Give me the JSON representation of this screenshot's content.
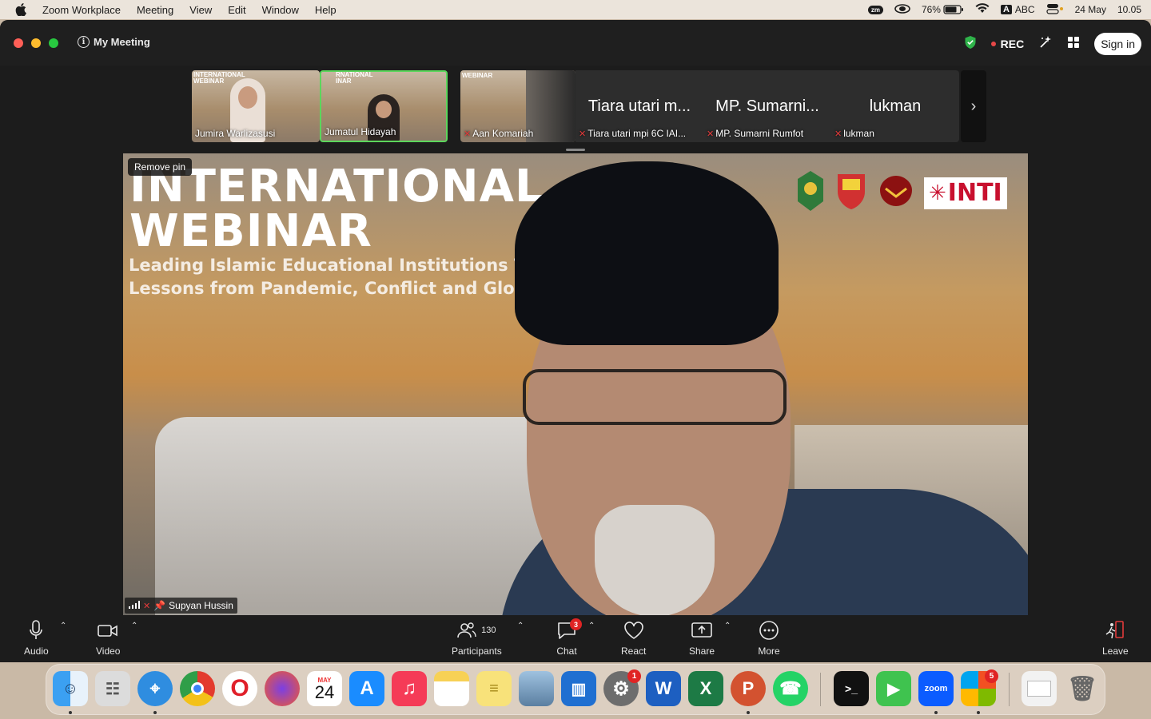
{
  "menubar": {
    "app_name": "Zoom Workplace",
    "items": [
      "Meeting",
      "View",
      "Edit",
      "Window",
      "Help"
    ],
    "status": {
      "zm": "zm",
      "battery": "76%",
      "input": "ABC",
      "input_letter": "A",
      "date": "24 May",
      "time": "10.05"
    }
  },
  "window": {
    "title": "My Meeting",
    "rec_label": "REC",
    "sign_in_label": "Sign in"
  },
  "strip": {
    "tiles": [
      {
        "name": "Jumira Warlizasusi",
        "thumb_line1": "INTERNATIONAL",
        "thumb_line2": "WEBINAR"
      },
      {
        "name": "Jumatul Hidayah",
        "thumb_line1": "RNATIONAL",
        "thumb_line2": "INAR"
      },
      {
        "name": "Aan Komariah",
        "thumb_line1": "WEBINAR"
      },
      {
        "name": "Tiara utari mpi 6C  IAI...",
        "big": "Tiara utari m..."
      },
      {
        "name": "MP. Sumarni Rumfot",
        "big": "MP. Sumarni..."
      },
      {
        "name": "lukman",
        "big": "lukman"
      }
    ]
  },
  "main_video": {
    "remove_pin_label": "Remove pin",
    "title_line1": "INTERNATIONAL",
    "title_line2": "WEBINAR",
    "subtitle_line1": "Leading Islamic Educational Institutions T",
    "subtitle_line2": "Lessons from Pandemic, Conflict and Glo",
    "brand": "INTI",
    "speaker_name": "Supyan Hussin"
  },
  "toolbar": {
    "audio": "Audio",
    "video": "Video",
    "participants": "Participants",
    "participants_count": "130",
    "chat": "Chat",
    "chat_badge": "3",
    "react": "React",
    "share": "Share",
    "more": "More",
    "leave": "Leave"
  },
  "dock": {
    "calendar_month": "MAY",
    "calendar_day": "24",
    "settings_badge": "1",
    "office_badge": "5",
    "zoom_label": "zoom"
  },
  "colors": {
    "accent_green": "#5cd65c",
    "rec_red": "#e64848",
    "badge_red": "#e02424",
    "inti_red": "#c8102e"
  }
}
